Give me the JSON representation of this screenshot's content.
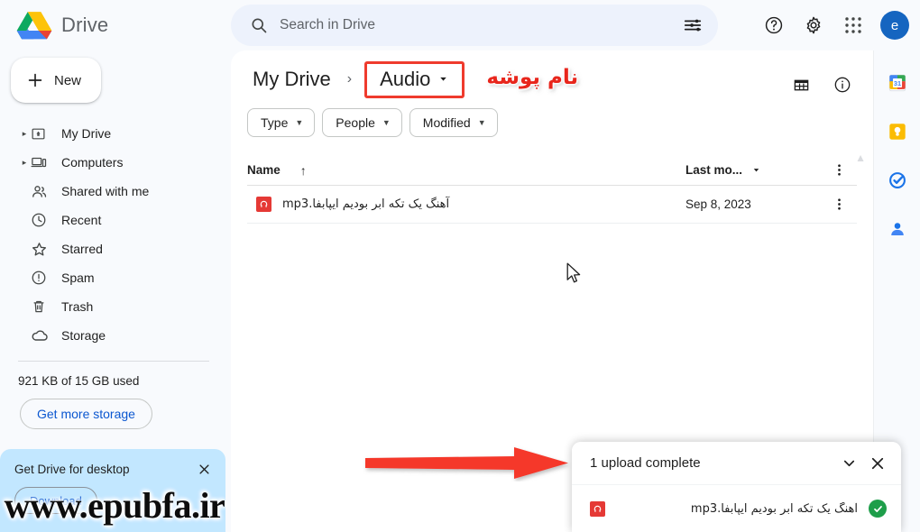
{
  "app": {
    "brand_title": "Drive",
    "logo_name": "google-drive-logo"
  },
  "search": {
    "placeholder": "Search in Drive",
    "value": "",
    "search_icon": "search-icon",
    "options_icon": "tune-options-icon"
  },
  "topbar_actions": [
    {
      "name": "help-icon",
      "label": "Help"
    },
    {
      "name": "gear-icon",
      "label": "Settings"
    },
    {
      "name": "apps-grid-icon",
      "label": "Google apps"
    }
  ],
  "account": {
    "avatar_initial": "e",
    "avatar_color": "#1565c0"
  },
  "sidebar": {
    "new_button": "New",
    "plus_icon": "plus-icon",
    "items": [
      {
        "label": "My Drive",
        "icon": "my-drive-icon",
        "expandable": true
      },
      {
        "label": "Computers",
        "icon": "computers-icon",
        "expandable": true
      },
      {
        "label": "Shared with me",
        "icon": "shared-with-me-icon",
        "expandable": false
      },
      {
        "label": "Recent",
        "icon": "clock-icon",
        "expandable": false
      },
      {
        "label": "Starred",
        "icon": "star-icon",
        "expandable": false
      },
      {
        "label": "Spam",
        "icon": "spam-icon",
        "expandable": false
      },
      {
        "label": "Trash",
        "icon": "trash-icon",
        "expandable": false
      },
      {
        "label": "Storage",
        "icon": "cloud-icon",
        "expandable": false
      }
    ],
    "storage_text": "921 KB of 15 GB used",
    "get_more_storage": "Get more storage"
  },
  "desktop_banner": {
    "title": "Get Drive for desktop",
    "close_icon": "close-icon",
    "download_label": "Download"
  },
  "watermark": {
    "text": "www.epubfa.ir"
  },
  "breadcrumb": {
    "root": "My Drive",
    "separator": "›",
    "current": "Audio",
    "caret_icon": "chevron-down-icon"
  },
  "annotations": {
    "folder_name_note": "نام پوشه",
    "note_color": "#e8261c",
    "box_color": "#ef3b2d",
    "arrow_color": "#f5372c",
    "arrow_name": "red-pointer-arrow"
  },
  "view_tools": [
    {
      "name": "grid-view-icon",
      "label": "Grid view"
    },
    {
      "name": "info-icon",
      "label": "View details"
    }
  ],
  "filters": [
    {
      "label": "Type",
      "name": "filter-chip-type"
    },
    {
      "label": "People",
      "name": "filter-chip-people"
    },
    {
      "label": "Modified",
      "name": "filter-chip-modified"
    }
  ],
  "file_table": {
    "columns": {
      "name": "Name",
      "sort_arrow": "↑",
      "last_modified": "Last mo...",
      "more": "more-options-icon"
    },
    "rows": [
      {
        "icon": "audio-file-icon",
        "name": "آهنگ یک تکه ابر بودیم ایپابفا.mp3",
        "last_modified": "Sep 8, 2023"
      }
    ]
  },
  "upload_toast": {
    "title": "1 upload complete",
    "collapse_icon": "chevron-down-icon",
    "close_icon": "close-icon",
    "items": [
      {
        "icon": "audio-file-icon",
        "name": "آهنگ یک تکه ابر بودیم ایپابفا.mp3",
        "status": "complete",
        "status_icon": "green-check-icon"
      }
    ]
  },
  "right_rail": [
    {
      "name": "google-calendar-icon",
      "label": "Calendar"
    },
    {
      "name": "google-keep-icon",
      "label": "Keep"
    },
    {
      "name": "google-tasks-icon",
      "label": "Tasks"
    },
    {
      "name": "google-contacts-icon",
      "label": "Contacts"
    }
  ]
}
